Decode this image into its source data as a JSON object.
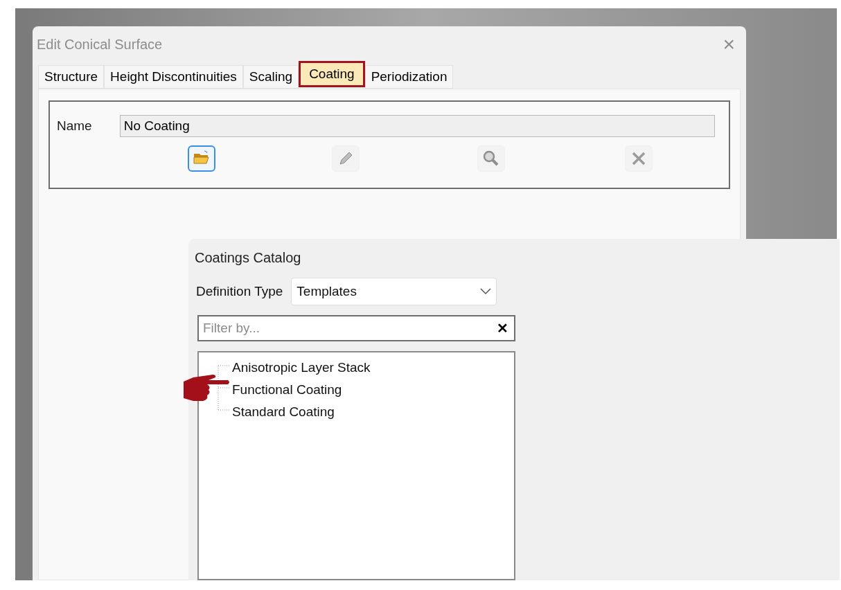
{
  "dialog": {
    "title": "Edit Conical Surface",
    "close": "×",
    "tabs": [
      {
        "label": "Structure",
        "selected": false
      },
      {
        "label": "Height Discontinuities",
        "selected": false
      },
      {
        "label": "Scaling",
        "selected": false
      },
      {
        "label": "Coating",
        "selected": true
      },
      {
        "label": "Periodization",
        "selected": false
      }
    ],
    "name_label": "Name",
    "name_value": "No Coating",
    "tools": [
      {
        "kind": "open",
        "focused": true
      },
      {
        "kind": "edit",
        "focused": false
      },
      {
        "kind": "view",
        "focused": false
      },
      {
        "kind": "remove",
        "focused": false
      }
    ]
  },
  "catalog": {
    "title": "Coatings Catalog",
    "definition_label": "Definition Type",
    "definition_value": "Templates",
    "filter": {
      "placeholder": "Filter by...",
      "clear": "✕"
    },
    "tree": [
      {
        "label": "Anisotropic Layer Stack",
        "pointed": false
      },
      {
        "label": "Functional Coating",
        "pointed": true
      },
      {
        "label": "Standard Coating",
        "pointed": false
      }
    ]
  }
}
